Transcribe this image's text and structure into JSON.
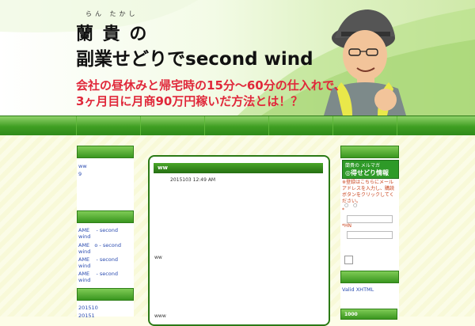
{
  "header": {
    "ruby": "らん たかし",
    "title_line1": "蘭 貴 の",
    "title_line2": "副業せどりでsecond wind",
    "subtitle_line1": "会社の昼休みと帰宅時の15分〜60分の仕入れで、",
    "subtitle_line2": "3ヶ月目に月商90万円稼いだ方法とは！？"
  },
  "left_sidebar": {
    "links": [
      "ww",
      "9"
    ],
    "recent": [
      {
        "a": "AME",
        "b": "- second",
        "c": "wind"
      },
      {
        "a": "AME",
        "b": "o - second",
        "c": "wind"
      },
      {
        "a": "AME",
        "b": "- second",
        "c": "wind"
      },
      {
        "a": "AME",
        "b": "- second",
        "c": "wind"
      }
    ],
    "archives": [
      "201510",
      "20151"
    ]
  },
  "main": {
    "post_title": "ww",
    "date": "2015103 12:49 AM",
    "body_text": "ww",
    "footer_text": "www"
  },
  "right_sidebar": {
    "mailmag_top": "蘭貴の メルマガ",
    "mailmag_title": "◎得せどり情報",
    "notice": "※登録はこちらにメールアドレスを入力し、購読ボタンをクリックしてください。",
    "name_label": "*",
    "hn_label": "*HN",
    "valid_xhtml": "Valid XHTML",
    "bottom_head": "1000"
  },
  "colors": {
    "accent": "#3a961f",
    "red_text": "#e0283a",
    "link": "#2a4bb0"
  }
}
